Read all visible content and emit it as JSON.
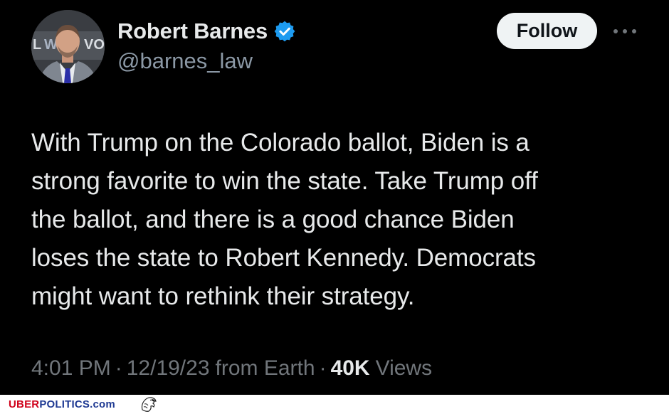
{
  "author": {
    "display_name": "Robert Barnes",
    "handle": "@barnes_law",
    "verified": true,
    "avatar_icon": "profile-photo"
  },
  "actions": {
    "follow_label": "Follow",
    "more_icon": "more-horizontal-icon"
  },
  "tweet": {
    "text": "With Trump on the Colorado ballot, Biden is a\nstrong favorite to win the state. Take Trump off\nthe ballot, and there is a good chance Biden\nloses the state to Robert Kennedy. Democrats\nmight want to rethink their strategy."
  },
  "meta": {
    "time": "4:01 PM",
    "separator": "·",
    "date": "12/19/23",
    "source": "from Earth",
    "views_count": "40K",
    "views_label": "Views"
  },
  "watermark": {
    "uber": "UBER",
    "politics": "POLITICS",
    "dotcom": ".com"
  },
  "colors": {
    "background": "#000000",
    "text_primary": "#e7e9ea",
    "text_secondary": "#71767b",
    "verified_badge": "#1d9bf0",
    "follow_bg": "#eff3f4"
  }
}
